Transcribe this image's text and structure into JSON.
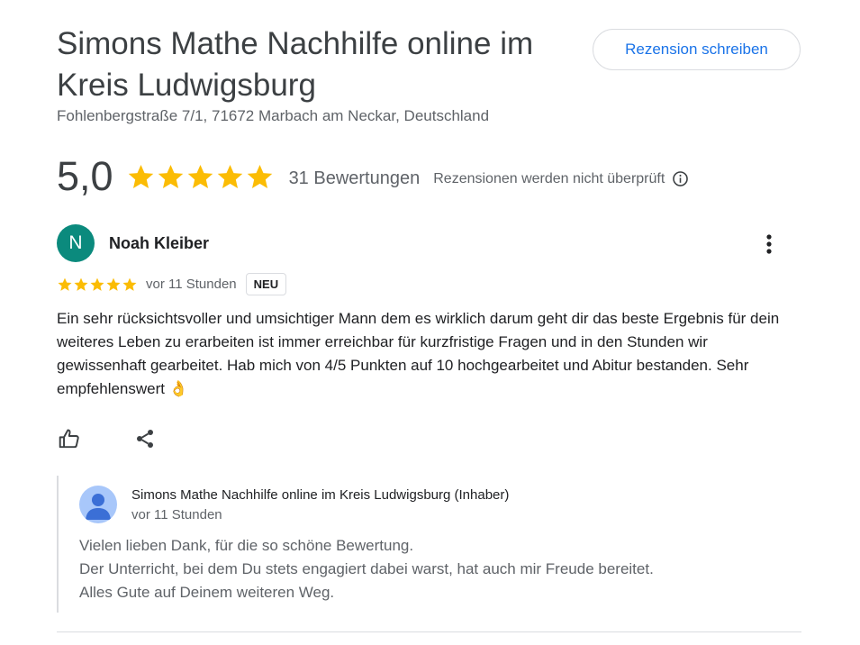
{
  "business": {
    "name": "Simons Mathe Nachhilfe online im Kreis Ludwigsburg",
    "address": "Fohlenbergstraße 7/1, 71672 Marbach am Neckar, Deutschland"
  },
  "actions": {
    "write_review_label": "Rezension schreiben"
  },
  "rating": {
    "value": "5,0",
    "stars": 5,
    "count_label": "31 Bewertungen",
    "unverified_note": "Rezensionen werden nicht überprüft"
  },
  "review": {
    "author_initial": "N",
    "author_name": "Noah Kleiber",
    "stars": 5,
    "time": "vor 11 Stunden",
    "badge": "NEU",
    "text": "Ein sehr rücksichtsvoller und umsichtiger Mann dem es wirklich darum geht dir das beste Ergebnis für dein weiteres Leben zu erarbeiten ist immer erreichbar für kurzfristige Fragen und in den Stunden wir gewissenhaft gearbeitet. Hab mich von 4/5 Punkten auf 10 hochgearbeitet und Abitur bestanden. Sehr empfehlenswert 👌"
  },
  "owner_reply": {
    "name": "Simons Mathe Nachhilfe online im Kreis Ludwigsburg (Inhaber)",
    "time": "vor 11 Stunden",
    "lines": [
      "Vielen lieben Dank, für die so schöne Bewertung.",
      "Der Unterricht, bei dem Du stets engagiert dabei warst, hat auch mir Freude bereitet.",
      "Alles Gute auf Deinem weiteren Weg."
    ]
  },
  "icons": {
    "star": "star-icon",
    "info": "info-icon",
    "more": "more-vert-icon",
    "like": "thumb-up-icon",
    "share": "share-icon",
    "owner_avatar": "person-icon"
  },
  "colors": {
    "star": "#fbbc04",
    "accent": "#1a73e8",
    "avatar": "#0b8a7d",
    "owner_avatar": "#a8c7fa"
  }
}
